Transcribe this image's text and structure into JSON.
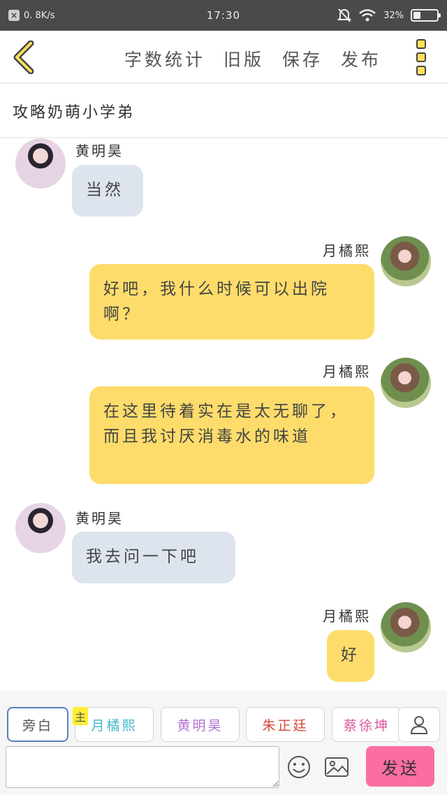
{
  "status_bar": {
    "net_speed": "0. 8K/s",
    "time": "17:30",
    "battery": "32%",
    "battery_level": 0.32
  },
  "toolbar": {
    "actions": [
      "字数统计",
      "旧版",
      "保存",
      "发布"
    ]
  },
  "story_title": "攻略奶萌小学弟",
  "messages": [
    {
      "side": "left",
      "name": "黄明昊",
      "text": "当然"
    },
    {
      "side": "right",
      "name": "月橘熙",
      "text": "好吧，我什么时候可以出院啊？"
    },
    {
      "side": "right",
      "name": "月橘熙",
      "text": "在这里待着实在是太无聊了，而且我讨厌消毒水的味道"
    },
    {
      "side": "left",
      "name": "黄明昊",
      "text": "我去问一下吧"
    },
    {
      "side": "right",
      "name": "月橘熙",
      "text": "好"
    }
  ],
  "characters": [
    {
      "label": "旁白",
      "color": "#555555"
    },
    {
      "label": "月橘熙",
      "color": "#3fb8c8"
    },
    {
      "label": "黄明昊",
      "color": "#b370d0"
    },
    {
      "label": "朱正廷",
      "color": "#d8463a"
    },
    {
      "label": "蔡徐坤",
      "color": "#d85aa0"
    }
  ],
  "host_tag": "主",
  "input": {
    "placeholder": ""
  },
  "send_label": "发送",
  "colors": {
    "accent_yellow": "#fddc6b",
    "bubble_left": "#dde4ee",
    "send_pink": "#fb6ea1",
    "active_border": "#5a7fbe"
  }
}
